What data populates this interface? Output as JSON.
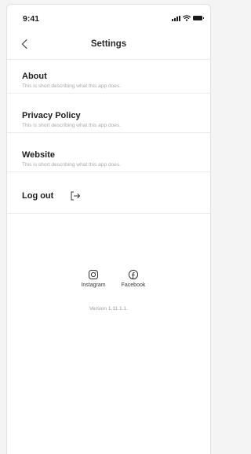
{
  "status_bar": {
    "time": "9:41"
  },
  "header": {
    "title": "Settings"
  },
  "menu": {
    "items": [
      {
        "title": "About",
        "description": "This is short describing what this app does."
      },
      {
        "title": "Privacy Policy",
        "description": "This is short describing what this app does."
      },
      {
        "title": "Website",
        "description": "This is short describing what this app does."
      }
    ],
    "logout_label": "Log out"
  },
  "social": {
    "instagram_label": "Instagram",
    "facebook_label": "Facebook"
  },
  "version": "Version 1.11.1.1.",
  "icons": {
    "back": "chevron-left-icon",
    "logout": "logout-arrow-icon",
    "instagram": "instagram-icon",
    "facebook": "facebook-icon"
  }
}
